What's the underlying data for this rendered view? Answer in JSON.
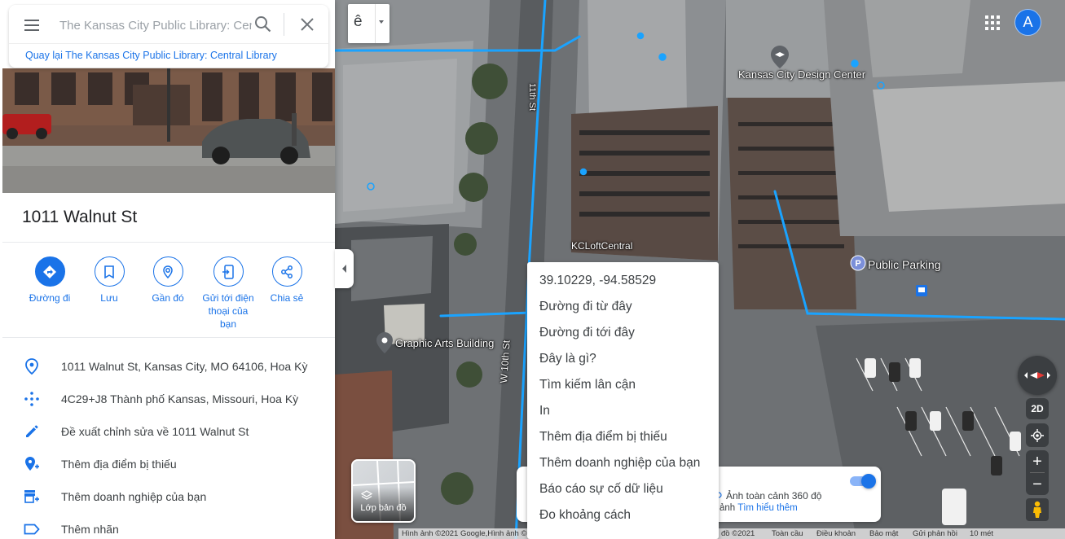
{
  "search": {
    "placeholder": "The Kansas City Public Library: Central Library",
    "back_link": "Quay lại The Kansas City Public Library: Central Library"
  },
  "place": {
    "title": "1011 Walnut St"
  },
  "actions": [
    {
      "label": "Đường đi",
      "icon": "directions-icon"
    },
    {
      "label": "Lưu",
      "icon": "bookmark-icon"
    },
    {
      "label": "Gần đó",
      "icon": "nearby-icon"
    },
    {
      "label": "Gửi tới điện thoại của bạn",
      "icon": "send-to-phone-icon"
    },
    {
      "label": "Chia sẻ",
      "icon": "share-icon"
    }
  ],
  "info": [
    {
      "text": "1011 Walnut St, Kansas City, MO 64106, Hoa Kỳ",
      "icon": "location-pin-icon"
    },
    {
      "text": "4C29+J8 Thành phố Kansas, Missouri, Hoa Kỳ",
      "icon": "plus-code-icon"
    },
    {
      "text": "Đề xuất chỉnh sửa về 1011 Walnut St",
      "icon": "edit-pencil-icon"
    },
    {
      "text": "Thêm địa điểm bị thiếu",
      "icon": "add-place-icon"
    },
    {
      "text": "Thêm doanh nghiệp của bạn",
      "icon": "add-business-icon"
    },
    {
      "text": "Thêm nhãn",
      "icon": "label-icon"
    }
  ],
  "map": {
    "transliteration_glyph": "ê",
    "avatar_letter": "A",
    "labels": {
      "design_center": "Kansas City Design Center",
      "public_parking": "Public Parking",
      "graphic_arts": "Graphic Arts Building",
      "kcloft": "KCLoftCentral",
      "street_w10": "W 10th St",
      "street_11": "11th St"
    },
    "layers_label": "Lớp bản đồ",
    "pano_line1": "Ảnh toàn cảnh 360 độ",
    "pano_line2_prefix": "nh ảnh",
    "pano_link": "Tìm hiểu thêm",
    "btn_2d": "2D"
  },
  "context_menu": {
    "coords": "39.10229, -94.58529",
    "items": [
      "Đường đi từ đây",
      "Đường đi tới đây",
      "Đây là gì?",
      "Tìm kiếm lân cận",
      "In",
      "Thêm địa điểm bị thiếu",
      "Thêm doanh nghiệp của bạn",
      "Báo cáo sự cố dữ liệu",
      "Đo khoảng cách"
    ]
  },
  "attribution": {
    "imagery": "Hình ảnh ©2021 Google,Hình ảnh ©",
    "map_data": "đồ ©2021",
    "terms": "Toàn cầu",
    "privacy_terms": "Điều khoản",
    "privacy": "Bảo mật",
    "feedback": "Gửi phản hồi",
    "scale": "10 mét"
  },
  "colors": {
    "accent": "#1a73e8",
    "route": "#1aa3ff"
  }
}
